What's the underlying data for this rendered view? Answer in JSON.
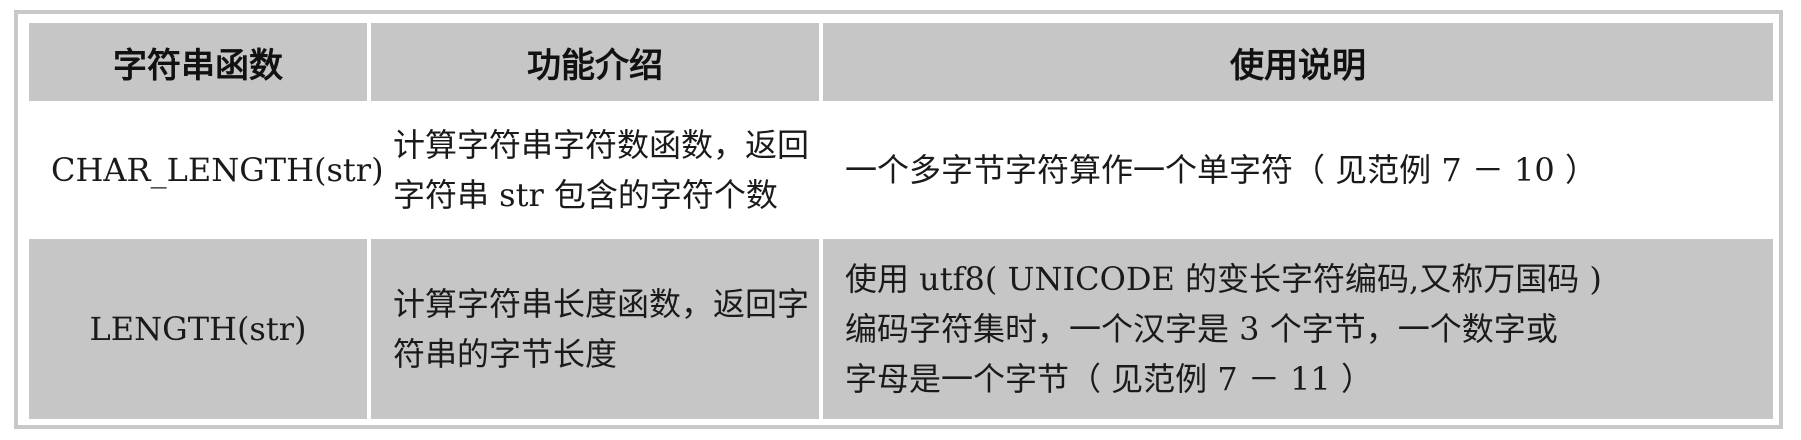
{
  "table": {
    "headers": [
      "字符串函数",
      "功能介绍",
      "使用说明"
    ],
    "rows": [
      {
        "function": "CHAR_LENGTH(str)",
        "description_lines": [
          "计算字符串字符数函数，返回",
          "字符串 str 包含的字符个数"
        ],
        "usage_lines": [
          "一个多字节字符算作一个单字符（ 见范例 7 － 10 ）"
        ]
      },
      {
        "function": "LENGTH(str)",
        "description_lines": [
          "计算字符串长度函数，返回字",
          "符串的字节长度"
        ],
        "usage_lines": [
          "使用 utf8( UNICODE 的变长字符编码,又称万国码 )",
          "编码字符集时，一个汉字是 3 个字节，一个数字或",
          "字母是一个字节（ 见范例 7 － 11 ）"
        ]
      }
    ]
  }
}
